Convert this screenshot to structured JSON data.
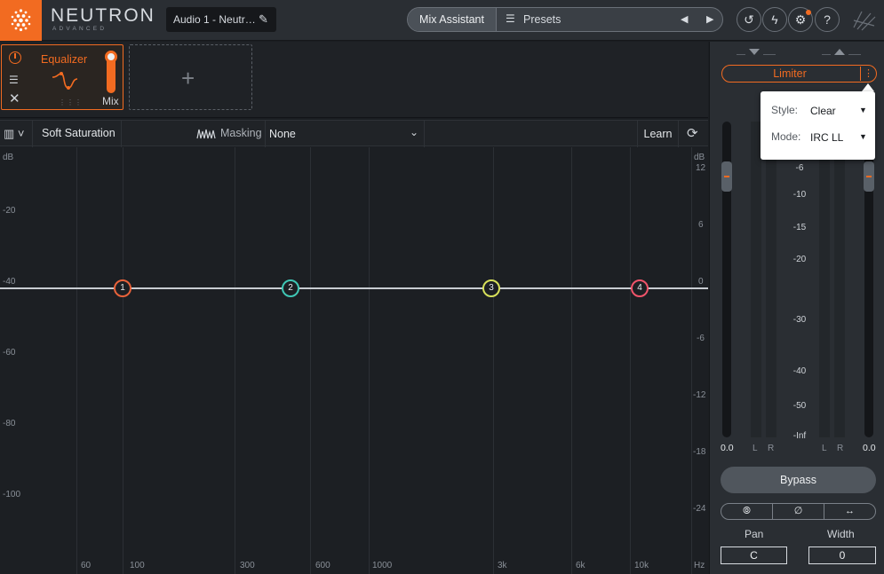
{
  "app": {
    "brand": "NEUTRON",
    "edition": "ADVANCED",
    "track_name": "Audio 1 - Neutr…",
    "accent": "#f26b21"
  },
  "header": {
    "mix_assistant": "Mix Assistant",
    "presets": "Presets"
  },
  "module": {
    "title": "Equalizer",
    "mix_label": "Mix"
  },
  "toolbar": {
    "mode": "Soft Saturation",
    "masking_label": "Masking",
    "masking_value": "None",
    "learn": "Learn"
  },
  "graph": {
    "left_scale": [
      "dB",
      "-20",
      "-40",
      "-60",
      "-80",
      "-100"
    ],
    "right_scale": [
      "dB",
      "12",
      "6",
      "0",
      "-6",
      "-12",
      "-18",
      "-24"
    ],
    "freq_labels": [
      "60",
      "100",
      "300",
      "600",
      "1000",
      "3k",
      "6k",
      "10k",
      "Hz"
    ],
    "nodes": [
      {
        "label": "1",
        "color": "#e8623a"
      },
      {
        "label": "2",
        "color": "#3fc7b5"
      },
      {
        "label": "3",
        "color": "#d7e05a"
      },
      {
        "label": "4",
        "color": "#f0546a"
      }
    ]
  },
  "limiter": {
    "label": "Limiter",
    "style_label": "Style:",
    "style_value": "Clear",
    "mode_label": "Mode:",
    "mode_value": "IRC LL"
  },
  "meters": {
    "scale": [
      "-6",
      "-10",
      "-15",
      "-20",
      "-30",
      "-40",
      "-50",
      "-Inf"
    ],
    "input_gain": "0.0",
    "output_gain": "0.0",
    "channels": [
      "L",
      "R",
      "L",
      "R"
    ]
  },
  "controls": {
    "bypass": "Bypass",
    "pan_label": "Pan",
    "pan_value": "C",
    "width_label": "Width",
    "width_value": "0"
  }
}
